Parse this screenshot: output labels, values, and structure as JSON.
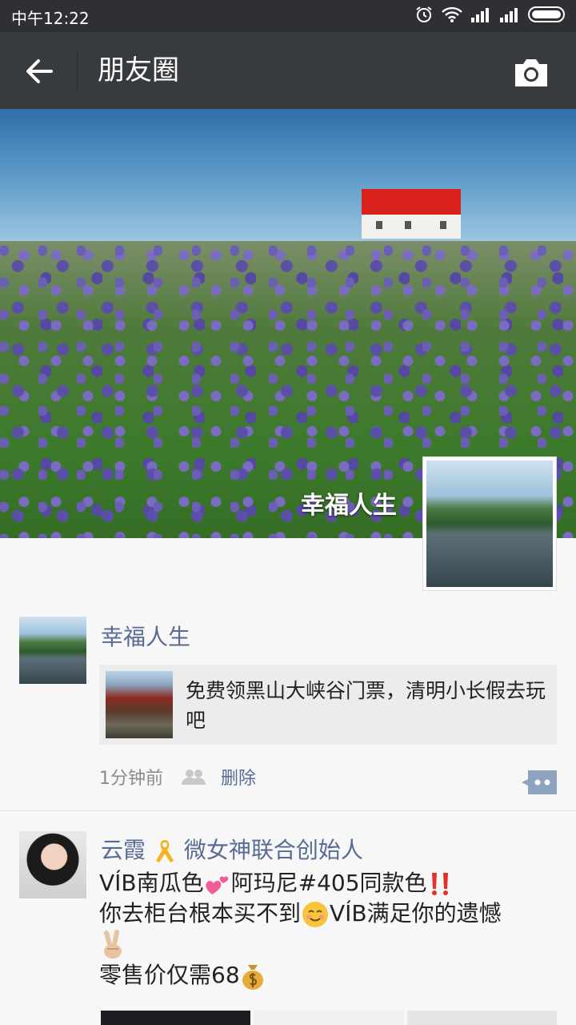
{
  "status_bar": {
    "time": "中午12:22"
  },
  "navbar": {
    "title": "朋友圈"
  },
  "cover": {
    "name": "幸福人生"
  },
  "posts": [
    {
      "author": "幸福人生",
      "share_text": "免费领黑山大峡谷门票，清明小长假去玩吧",
      "time": "1分钟前",
      "delete_label": "删除"
    },
    {
      "author_prefix": "云霞",
      "author_suffix": "微女神联合创始人",
      "line1a": "VÍB南瓜色",
      "line1b": "阿玛尼#405同款色",
      "line2": "你去柜台根本买不到",
      "line2b": "VÍB满足你的遗憾",
      "line3": "零售价仅需68"
    }
  ],
  "colors": {
    "nav": "#383b3e",
    "status": "#2e3033",
    "link": "#576b95"
  }
}
